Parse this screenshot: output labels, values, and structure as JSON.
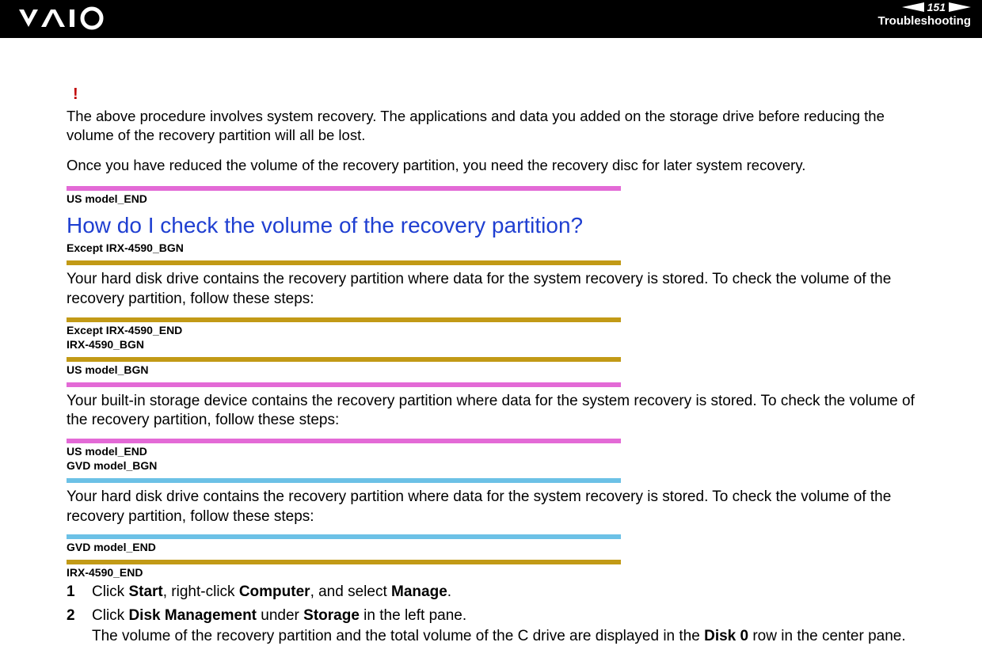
{
  "header": {
    "page_number": "151",
    "section": "Troubleshooting"
  },
  "warning": {
    "bang": "!",
    "para1": "The above procedure involves system recovery. The applications and data you added on the storage drive before reducing the volume of the recovery partition will all be lost.",
    "para2": "Once you have reduced the volume of the recovery partition, you need the recovery disc for later system recovery."
  },
  "tags": {
    "us_end_1": "US model_END",
    "except_irx_bgn": "Except IRX-4590_BGN",
    "except_irx_end": "Except IRX-4590_END",
    "irx_bgn": "IRX-4590_BGN",
    "us_bgn": "US model_BGN",
    "us_end_2": "US model_END",
    "gvd_bgn": "GVD model_BGN",
    "gvd_end": "GVD model_END",
    "irx_end": "IRX-4590_END"
  },
  "title": "How do I check the volume of the recovery partition?",
  "paragraphs": {
    "p1": "Your hard disk drive contains the recovery partition where data for the system recovery is stored. To check the volume of the recovery partition, follow these steps:",
    "p2": "Your built-in storage device contains the recovery partition where data for the system recovery is stored. To check the volume of the recovery partition, follow these steps:",
    "p3": "Your hard disk drive contains the recovery partition where data for the system recovery is stored. To check the volume of the recovery partition, follow these steps:"
  },
  "steps": {
    "s1": {
      "num": "1",
      "pre": "Click ",
      "b1": "Start",
      "mid1": ", right-click ",
      "b2": "Computer",
      "mid2": ", and select ",
      "b3": "Manage",
      "post": "."
    },
    "s2": {
      "num": "2",
      "line1_pre": "Click ",
      "line1_b1": "Disk Management",
      "line1_mid": " under ",
      "line1_b2": "Storage",
      "line1_post": " in the left pane.",
      "line2_pre": "The volume of the recovery partition and the total volume of the C drive are displayed in the ",
      "line2_b1": "Disk 0",
      "line2_post": " row in the center pane."
    }
  }
}
